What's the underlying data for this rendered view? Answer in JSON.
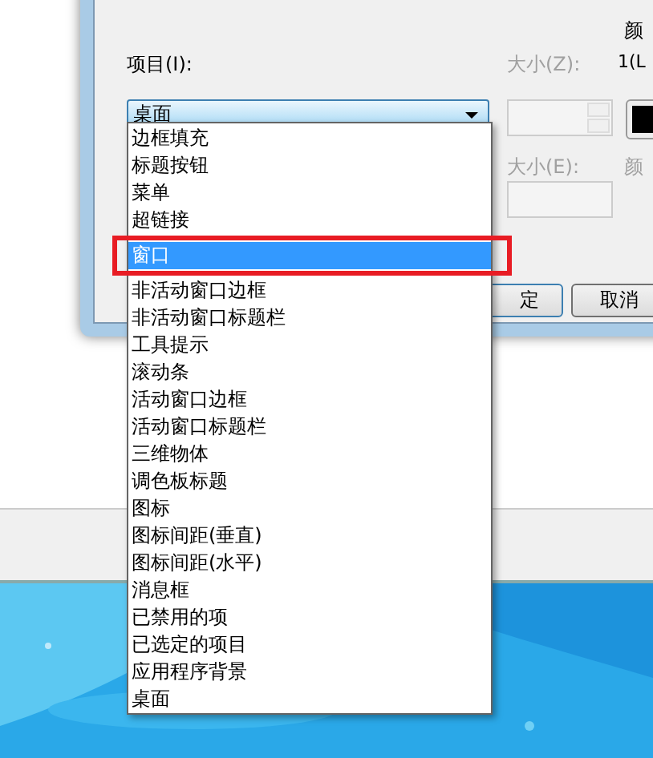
{
  "dialog": {
    "item_label": "项目(I):",
    "item_value": "桌面",
    "size1_label": "大小(Z):",
    "color1_label": "颜",
    "color1_value": "1(L",
    "size2_label": "大小(E):",
    "color2_label": "颜",
    "buttons": [
      {
        "label": "定"
      },
      {
        "label": "取消"
      }
    ]
  },
  "dropdown": {
    "items": [
      {
        "label": "边框填充",
        "selected": false
      },
      {
        "label": "标题按钮",
        "selected": false
      },
      {
        "label": "菜单",
        "selected": false
      },
      {
        "label": "超链接",
        "selected": false
      },
      {
        "label": "窗口",
        "selected": true
      },
      {
        "label": "非活动窗口边框",
        "selected": false
      },
      {
        "label": "非活动窗口标题栏",
        "selected": false
      },
      {
        "label": "工具提示",
        "selected": false
      },
      {
        "label": "滚动条",
        "selected": false
      },
      {
        "label": "活动窗口边框",
        "selected": false
      },
      {
        "label": "活动窗口标题栏",
        "selected": false
      },
      {
        "label": "三维物体",
        "selected": false
      },
      {
        "label": "调色板标题",
        "selected": false
      },
      {
        "label": "图标",
        "selected": false
      },
      {
        "label": "图标间距(垂直)",
        "selected": false
      },
      {
        "label": "图标间距(水平)",
        "selected": false
      },
      {
        "label": "消息框",
        "selected": false
      },
      {
        "label": "已禁用的项",
        "selected": false
      },
      {
        "label": "已选定的项目",
        "selected": false
      },
      {
        "label": "应用程序背景",
        "selected": false
      },
      {
        "label": "桌面",
        "selected": false
      }
    ]
  }
}
